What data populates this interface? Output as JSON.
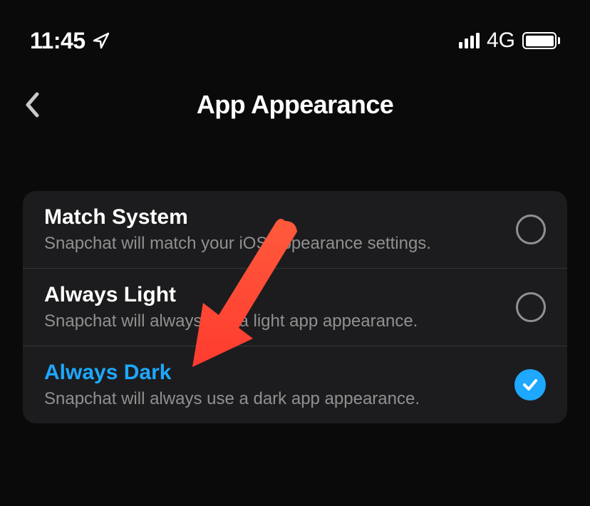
{
  "status_bar": {
    "time": "11:45",
    "network_type": "4G"
  },
  "header": {
    "title": "App Appearance"
  },
  "options": [
    {
      "title": "Match System",
      "subtitle": "Snapchat will match your iOS appearance settings.",
      "selected": false
    },
    {
      "title": "Always Light",
      "subtitle": "Snapchat will always use a light app appearance.",
      "selected": false
    },
    {
      "title": "Always Dark",
      "subtitle": "Snapchat will always use a dark app appearance.",
      "selected": true
    }
  ]
}
